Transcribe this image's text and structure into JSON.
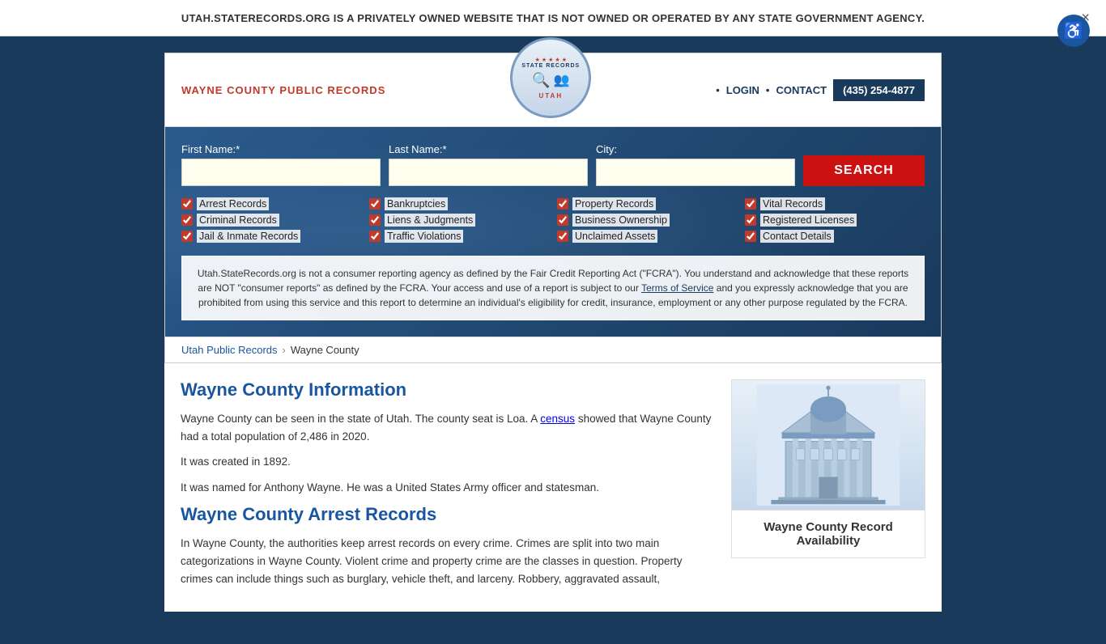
{
  "banner": {
    "text": "UTAH.STATERECORDS.ORG IS A PRIVATELY OWNED WEBSITE THAT IS NOT OWNED OR OPERATED BY ANY STATE GOVERNMENT AGENCY.",
    "close_label": "×"
  },
  "accessibility": {
    "label": "♿"
  },
  "header": {
    "site_title": "WAYNE COUNTY PUBLIC RECORDS",
    "logo_text_top": "STATE RECORDS",
    "logo_text_bottom": "UTAH",
    "nav_login": "LOGIN",
    "nav_contact": "CONTACT",
    "phone": "(435) 254-4877"
  },
  "search": {
    "first_name_label": "First Name:*",
    "last_name_label": "Last Name:*",
    "city_label": "City:",
    "first_name_placeholder": "",
    "last_name_placeholder": "",
    "city_placeholder": "",
    "button_label": "SEARCH"
  },
  "checkboxes": [
    {
      "col": 1,
      "items": [
        "Arrest Records",
        "Criminal Records",
        "Jail & Inmate Records"
      ]
    },
    {
      "col": 2,
      "items": [
        "Bankruptcies",
        "Liens & Judgments",
        "Traffic Violations"
      ]
    },
    {
      "col": 3,
      "items": [
        "Property Records",
        "Business Ownership",
        "Unclaimed Assets"
      ]
    },
    {
      "col": 4,
      "items": [
        "Vital Records",
        "Registered Licenses",
        "Contact Details"
      ]
    }
  ],
  "disclaimer": {
    "text": "Utah.StateRecords.org is not a consumer reporting agency as defined by the Fair Credit Reporting Act (\"FCRA\"). You understand and acknowledge that these reports are NOT \"consumer reports\" as defined by the FCRA. Your access and use of a report is subject to our ",
    "link_text": "Terms of Service",
    "text2": " and you expressly acknowledge that you are prohibited from using this service and this report to determine an individual's eligibility for credit, insurance, employment or any other purpose regulated by the FCRA."
  },
  "breadcrumb": {
    "link_label": "Utah Public Records",
    "separator": "›",
    "current": "Wayne County"
  },
  "content": {
    "section1_title": "Wayne County Information",
    "para1": "Wayne County can be seen in the state of Utah. The county seat is Loa. A census showed that Wayne County had a total population of 2,486 in 2020.",
    "para2": "It was created in 1892.",
    "para3": "It was named for Anthony Wayne. He was a United States Army officer and statesman.",
    "section2_title": "Wayne County Arrest Records",
    "para4": "In Wayne County, the authorities keep arrest records on every crime. Crimes are split into two main categorizations in Wayne County. Violent crime and property crime are the classes in question. Property crimes can include things such as burglary, vehicle theft, and larceny. Robbery, aggravated assault,",
    "census_link": "census"
  },
  "sidebar": {
    "card_title": "Wayne County Record Availability"
  }
}
